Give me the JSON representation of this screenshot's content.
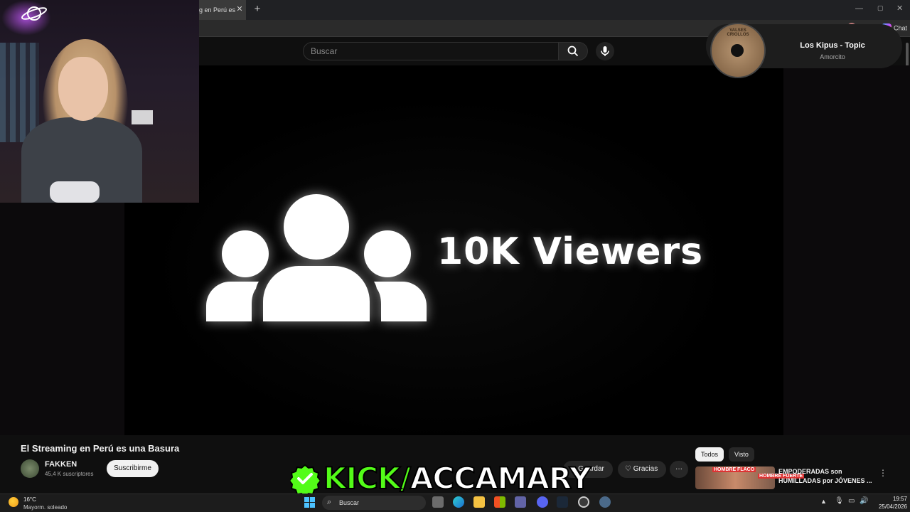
{
  "browser": {
    "tab_title": "g en Perú es",
    "tab_close": "✕",
    "new_tab": "+",
    "chat_label": "Chat",
    "window_min": "—",
    "window_max": "▢",
    "window_close": "✕"
  },
  "youtube": {
    "search_placeholder": "Buscar",
    "video": {
      "overlay_text": "10K Viewers"
    },
    "video_title": "El Streaming en Perú es una Basura",
    "channel_name": "FAKKEN",
    "subscribers": "45,4 K suscriptores",
    "subscribe_label": "Suscribirme",
    "actions": {
      "save_label": "Guardar",
      "thanks_label": "Gracias",
      "more_label": "···"
    },
    "filters": [
      "Todos",
      "Visto"
    ],
    "recommended": {
      "title": "EMPODERADAS son HUMILLADAS por JÓVENES ...",
      "thumb_label_a": "HOMBRE FLACO",
      "thumb_label_b": "HOMBRE FUERTE"
    }
  },
  "music": {
    "album_label": "VALSES CRIOLLOS",
    "title": "Los Kipus - Topic",
    "subtitle": "Amorcito"
  },
  "stream": {
    "kick_handle_prefix": "KICK/",
    "kick_handle_name": "ACCAMARY"
  },
  "taskbar": {
    "weather_temp": "16°C",
    "weather_desc": "Mayorm. soleado",
    "search_label": "Buscar",
    "time": "19:57",
    "date": "25/04/2026"
  },
  "colors": {
    "kick_green": "#53fc18",
    "background": "#0f0f0f"
  }
}
